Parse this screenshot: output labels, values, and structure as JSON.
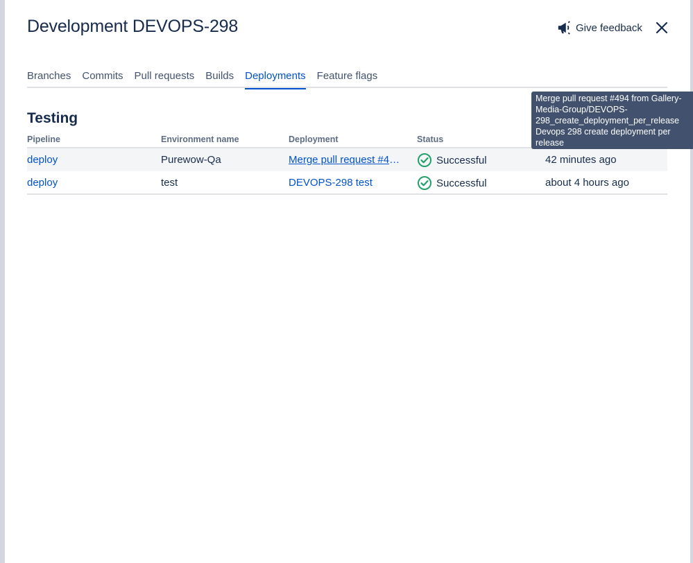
{
  "modal": {
    "title": "Development DEVOPS-298",
    "feedback_label": "Give feedback"
  },
  "tabs": [
    {
      "label": "Branches"
    },
    {
      "label": "Commits"
    },
    {
      "label": "Pull requests"
    },
    {
      "label": "Builds"
    },
    {
      "label": "Deployments"
    },
    {
      "label": "Feature flags"
    }
  ],
  "section": {
    "title": "Testing"
  },
  "table": {
    "headers": {
      "pipeline": "Pipeline",
      "environment": "Environment name",
      "deployment": "Deployment",
      "status": "Status"
    },
    "rows": [
      {
        "pipeline": "deploy",
        "environment": "Purewow-Qa",
        "deployment": "Merge pull request #494 from Gallery-Media-Group/DEVOPS-298_create_deployment_per_release Devops 298 create deployment per release",
        "status": "Successful",
        "time": "42 minutes ago"
      },
      {
        "pipeline": "deploy",
        "environment": "test",
        "deployment": "DEVOPS-298 test",
        "status": "Successful",
        "time": "about 4 hours ago"
      }
    ]
  },
  "tooltip": {
    "text": "Merge pull request #494 from Gallery-Media-Group/DEVOPS-298_create_deployment_per_release Devops 298 create deployment per release"
  },
  "colors": {
    "accent": "#0052cc",
    "success": "#22a06b",
    "tooltip_bg": "#42526e"
  }
}
